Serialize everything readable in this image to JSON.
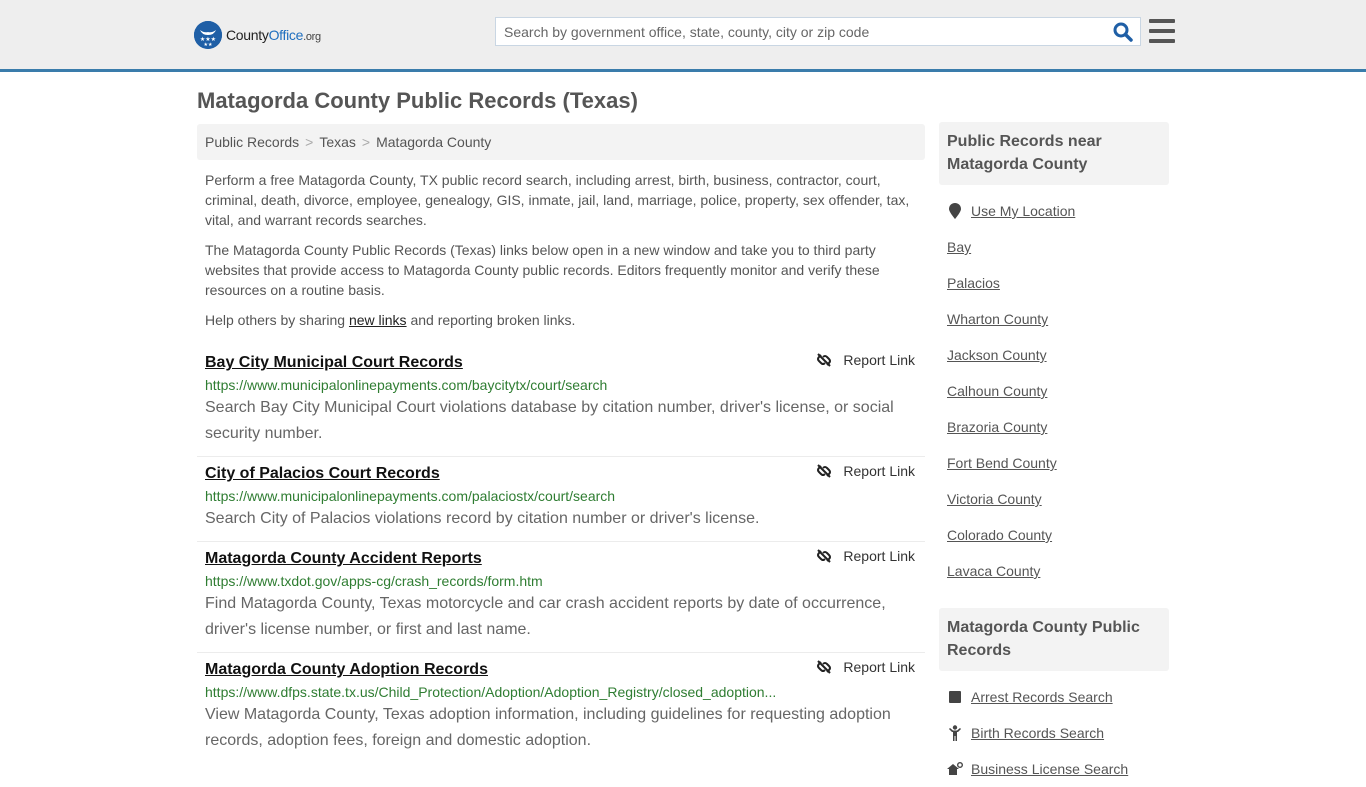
{
  "header": {
    "logo": {
      "county": "County",
      "office": "Office",
      "org": ".org"
    },
    "search_placeholder": "Search by government office, state, county, city or zip code",
    "search_value": ""
  },
  "page_title": "Matagorda County Public Records (Texas)",
  "breadcrumb": [
    "Public Records",
    "Texas",
    "Matagorda County"
  ],
  "intro": {
    "p1": "Perform a free Matagorda County, TX public record search, including arrest, birth, business, contractor, court, criminal, death, divorce, employee, genealogy, GIS, inmate, jail, land, marriage, police, property, sex offender, tax, vital, and warrant records searches.",
    "p2": "The Matagorda County Public Records (Texas) links below open in a new window and take you to third party websites that provide access to Matagorda County public records. Editors frequently monitor and verify these resources on a routine basis.",
    "p3_before": "Help others by sharing ",
    "p3_link": "new links",
    "p3_after": " and reporting broken links."
  },
  "report_label": "Report Link",
  "records": [
    {
      "title": "Bay City Municipal Court Records",
      "url": "https://www.municipalonlinepayments.com/baycitytx/court/search",
      "description": "Search Bay City Municipal Court violations database by citation number, driver's license, or social security number."
    },
    {
      "title": "City of Palacios Court Records",
      "url": "https://www.municipalonlinepayments.com/palaciostx/court/search",
      "description": "Search City of Palacios violations record by citation number or driver's license."
    },
    {
      "title": "Matagorda County Accident Reports",
      "url": "https://www.txdot.gov/apps-cg/crash_records/form.htm",
      "description": "Find Matagorda County, Texas motorcycle and car crash accident reports by date of occurrence, driver's license number, or first and last name."
    },
    {
      "title": "Matagorda County Adoption Records",
      "url": "https://www.dfps.state.tx.us/Child_Protection/Adoption/Adoption_Registry/closed_adoption...",
      "description": "View Matagorda County, Texas adoption information, including guidelines for requesting adoption records, adoption fees, foreign and domestic adoption."
    }
  ],
  "sidebar": {
    "nearby": {
      "heading": "Public Records near Matagorda County",
      "use_location": "Use My Location",
      "items": [
        "Bay",
        "Palacios",
        "Wharton County",
        "Jackson County",
        "Calhoun County",
        "Brazoria County",
        "Fort Bend County",
        "Victoria County",
        "Colorado County",
        "Lavaca County"
      ]
    },
    "county_records": {
      "heading": "Matagorda County Public Records",
      "items": [
        {
          "label": "Arrest Records Search",
          "icon": "square-icon"
        },
        {
          "label": "Birth Records Search",
          "icon": "child-icon"
        },
        {
          "label": "Business License Search",
          "icon": "business-icon"
        }
      ]
    }
  },
  "colors": {
    "header_bg": "#eeeeee",
    "header_border": "#3a7cab",
    "brand_blue": "#1f5fa6",
    "url_green": "#2f7d32",
    "search_icon": "#1f5fa6"
  }
}
